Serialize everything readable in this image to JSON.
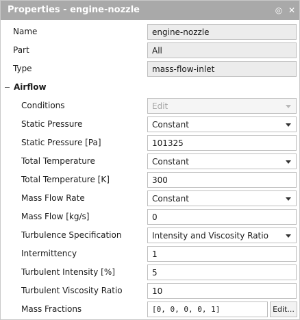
{
  "panel": {
    "title": "Properties - engine-nozzle",
    "buttons": {
      "float_icon": "◎",
      "close_icon": "✕"
    }
  },
  "general": {
    "name_label": "Name",
    "name_value": "engine-nozzle",
    "part_label": "Part",
    "part_value": "All",
    "type_label": "Type",
    "type_value": "mass-flow-inlet"
  },
  "airflow": {
    "section_label": "Airflow",
    "conditions_label": "Conditions",
    "conditions_value": "Edit",
    "static_pressure_label": "Static Pressure",
    "static_pressure_value": "Constant",
    "static_pressure_pa_label": "Static Pressure [Pa]",
    "static_pressure_pa_value": "101325",
    "total_temperature_label": "Total Temperature",
    "total_temperature_value": "Constant",
    "total_temperature_k_label": "Total Temperature [K]",
    "total_temperature_k_value": "300",
    "mass_flow_rate_label": "Mass Flow Rate",
    "mass_flow_rate_value": "Constant",
    "mass_flow_label": "Mass Flow [kg/s]",
    "mass_flow_value": "0",
    "turbulence_spec_label": "Turbulence Specification",
    "turbulence_spec_value": "Intensity and Viscosity Ratio",
    "intermittency_label": "Intermittency",
    "intermittency_value": "1",
    "turbulent_intensity_label": "Turbulent Intensity [%]",
    "turbulent_intensity_value": "5",
    "turbulent_viscosity_ratio_label": "Turbulent Viscosity Ratio",
    "turbulent_viscosity_ratio_value": "10",
    "mass_fractions_label": "Mass Fractions",
    "mass_fractions_value": "[0, 0, 0, 0, 1]",
    "mass_fractions_edit": "Edit..."
  },
  "colors": {
    "titlebar": "#a9a9a9",
    "readonly_field": "#ececec",
    "field_border": "#bdbdbd"
  }
}
